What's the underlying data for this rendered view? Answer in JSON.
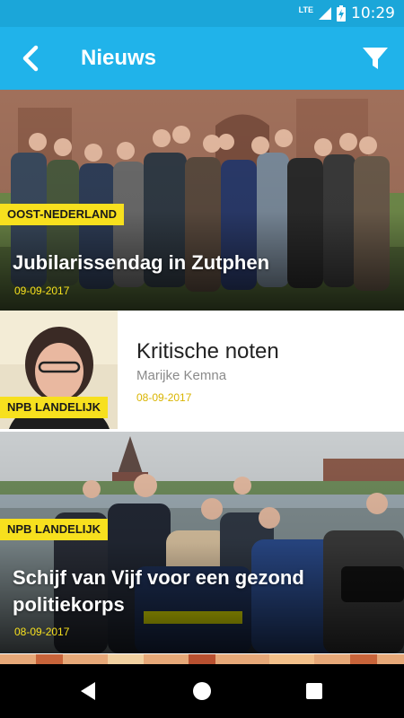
{
  "status_bar": {
    "network": "LTE",
    "time": "10:29",
    "icons": [
      "signal-icon",
      "battery-charging-icon"
    ]
  },
  "app_bar": {
    "title": "Nieuws",
    "back_icon": "chevron-left-icon",
    "filter_icon": "filter-icon",
    "background": "#20b3ea"
  },
  "articles": [
    {
      "tag": "OOST-NEDERLAND",
      "title": "Jubilarissendag in Zutphen",
      "date": "09-09-2017"
    },
    {
      "tag": "NPB LANDELIJK",
      "title": "Kritische noten",
      "author": "Marijke Kemna",
      "date": "08-09-2017"
    },
    {
      "tag": "NPB LANDELIJK",
      "title": "Schijf van Vijf voor een gezond politiekorps",
      "date": "08-09-2017"
    }
  ],
  "nav_bar": {
    "back_icon": "triangle-back-icon",
    "home_icon": "circle-home-icon",
    "recents_icon": "square-recents-icon"
  },
  "colors": {
    "accent_yellow": "#f7e01e",
    "status_bar": "#1ba6d9"
  }
}
